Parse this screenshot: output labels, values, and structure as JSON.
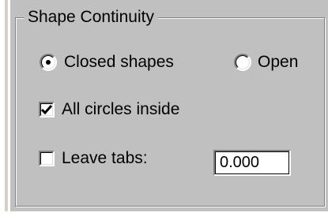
{
  "group": {
    "title": "Shape Continuity"
  },
  "closed_shapes": {
    "label": "Closed shapes",
    "selected": true
  },
  "open": {
    "label": "Open",
    "selected": false
  },
  "all_circles_inside": {
    "label": "All circles inside",
    "checked": true
  },
  "leave_tabs": {
    "label": "Leave tabs:",
    "checked": false,
    "value": "0.000"
  }
}
